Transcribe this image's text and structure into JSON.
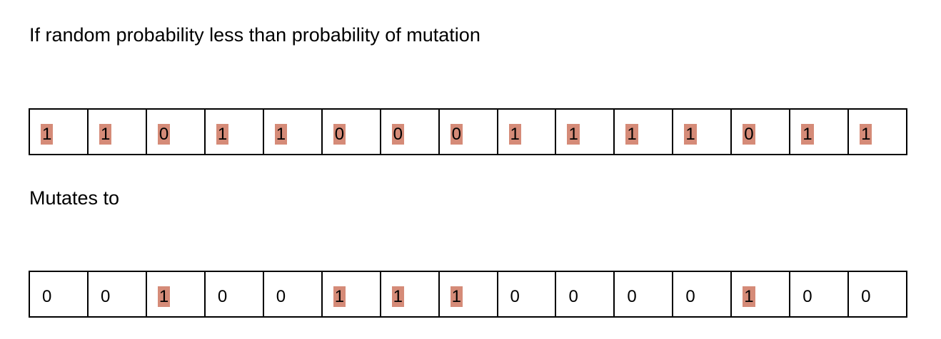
{
  "caption_top": "If random probability less than probability of mutation",
  "caption_middle": "Mutates to",
  "highlight_color": "#d58b78",
  "original_bits": [
    {
      "value": "1",
      "highlighted": true
    },
    {
      "value": "1",
      "highlighted": true
    },
    {
      "value": "0",
      "highlighted": true
    },
    {
      "value": "1",
      "highlighted": true
    },
    {
      "value": "1",
      "highlighted": true
    },
    {
      "value": "0",
      "highlighted": true
    },
    {
      "value": "0",
      "highlighted": true
    },
    {
      "value": "0",
      "highlighted": true
    },
    {
      "value": "1",
      "highlighted": true
    },
    {
      "value": "1",
      "highlighted": true
    },
    {
      "value": "1",
      "highlighted": true
    },
    {
      "value": "1",
      "highlighted": true
    },
    {
      "value": "0",
      "highlighted": true
    },
    {
      "value": "1",
      "highlighted": true
    },
    {
      "value": "1",
      "highlighted": true
    }
  ],
  "mutated_bits": [
    {
      "value": "0",
      "highlighted": false
    },
    {
      "value": "0",
      "highlighted": false
    },
    {
      "value": "1",
      "highlighted": true
    },
    {
      "value": "0",
      "highlighted": false
    },
    {
      "value": "0",
      "highlighted": false
    },
    {
      "value": "1",
      "highlighted": true
    },
    {
      "value": "1",
      "highlighted": true
    },
    {
      "value": "1",
      "highlighted": true
    },
    {
      "value": "0",
      "highlighted": false
    },
    {
      "value": "0",
      "highlighted": false
    },
    {
      "value": "0",
      "highlighted": false
    },
    {
      "value": "0",
      "highlighted": false
    },
    {
      "value": "1",
      "highlighted": true
    },
    {
      "value": "0",
      "highlighted": false
    },
    {
      "value": "0",
      "highlighted": false
    }
  ]
}
